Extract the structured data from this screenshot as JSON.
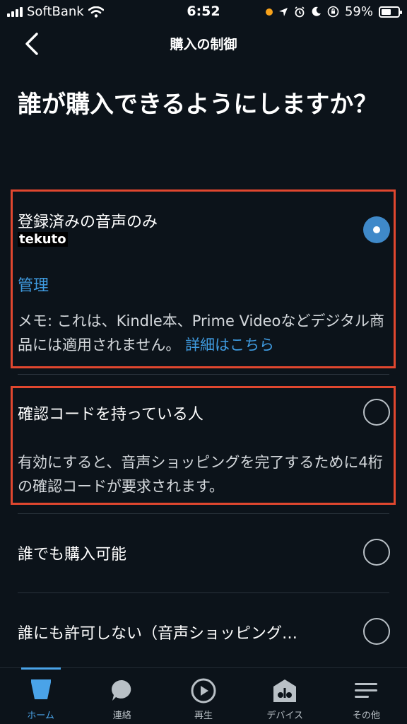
{
  "status_bar": {
    "carrier": "SoftBank",
    "time": "6:52",
    "battery": "59%"
  },
  "header": {
    "title": "購入の制御"
  },
  "page": {
    "heading": "誰が購入できるようにしますか？"
  },
  "options": [
    {
      "title": "登録済みの音声のみ",
      "user": "tekuto",
      "manage_link": "管理",
      "note": "メモ: これは、Kindle本、Prime Videoなどデジタル商品には適用されません。",
      "details_link": "詳細はこちら",
      "selected": true
    },
    {
      "title": "確認コードを持っている人",
      "description": "有効にすると、音声ショッピングを完了するために4桁の確認コードが要求されます。",
      "selected": false
    },
    {
      "title": "誰でも購入可能",
      "selected": false
    },
    {
      "title": "誰にも許可しない（音声ショッピング…",
      "selected": false
    }
  ],
  "tabs": [
    {
      "label": "ホーム",
      "icon": "home-icon",
      "active": true
    },
    {
      "label": "連絡",
      "icon": "chat-icon",
      "active": false
    },
    {
      "label": "再生",
      "icon": "play-icon",
      "active": false
    },
    {
      "label": "デバイス",
      "icon": "devices-icon",
      "active": false
    },
    {
      "label": "その他",
      "icon": "menu-icon",
      "active": false
    }
  ],
  "colors": {
    "background": "#0c131a",
    "accent": "#4aa3e8",
    "highlight_box": "#e0472f",
    "radio_selected": "#3f89c9"
  }
}
